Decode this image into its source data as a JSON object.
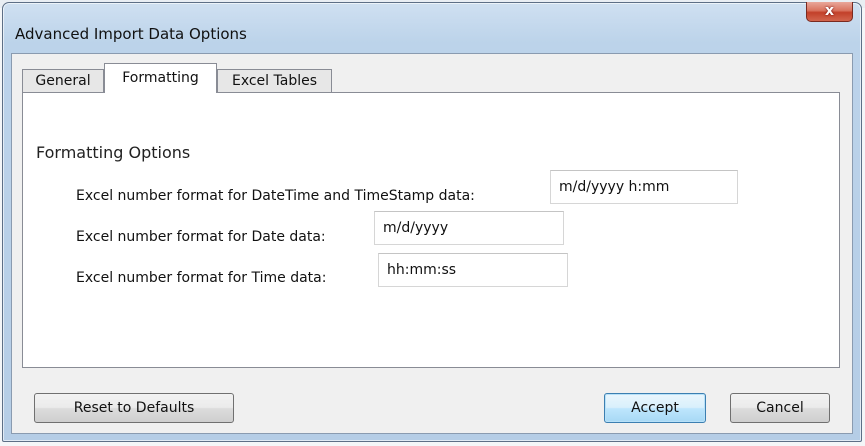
{
  "window": {
    "title": "Advanced Import Data Options",
    "close_label": "x"
  },
  "tabs": [
    {
      "label": "General"
    },
    {
      "label": "Formatting",
      "active": true
    },
    {
      "label": "Excel Tables"
    }
  ],
  "formatting": {
    "group_label": "Formatting Options",
    "fields": [
      {
        "label": "Excel number format for DateTime and TimeStamp data:",
        "value": "m/d/yyyy h:mm"
      },
      {
        "label": "Excel number format for Date data:",
        "value": "m/d/yyyy"
      },
      {
        "label": "Excel number format for Time data:",
        "value": "hh:mm:ss"
      }
    ]
  },
  "buttons": {
    "reset": "Reset to Defaults",
    "accept": "Accept",
    "cancel": "Cancel"
  }
}
